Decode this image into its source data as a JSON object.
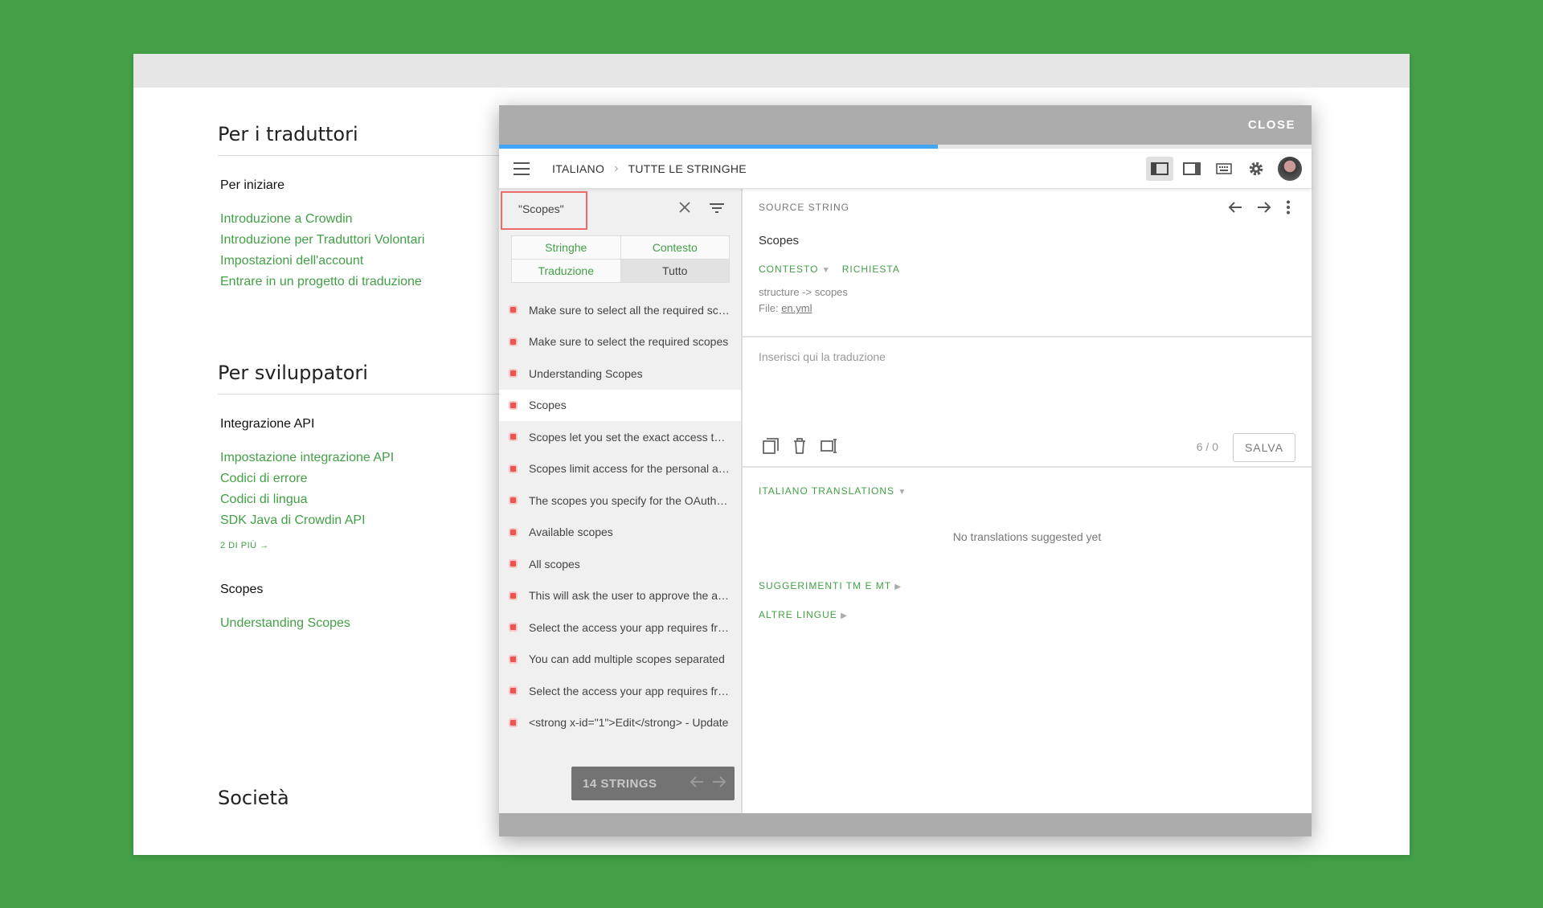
{
  "docs": {
    "translators": {
      "title": "Per i traduttori",
      "subtitle": "Per iniziare",
      "links": [
        "Introduzione a Crowdin",
        "Introduzione per Traduttori Volontari",
        "Impostazioni dell'account",
        "Entrare in un progetto di traduzione"
      ]
    },
    "developers": {
      "title": "Per sviluppatori",
      "subtitle": "Integrazione API",
      "links": [
        "Impostazione integrazione API",
        "Codici di errore",
        "Codici di lingua",
        "SDK Java di Crowdin API"
      ],
      "more": "2 DI PIÙ →",
      "scopes_title": "Scopes",
      "scopes_links": [
        "Understanding Scopes"
      ]
    },
    "company": {
      "title": "Società"
    }
  },
  "modal": {
    "close_label": "CLOSE",
    "progress": 0.54,
    "breadcrumb": {
      "language": "ITALIANO",
      "section": "TUTTE LE STRINGHE"
    },
    "icons": [
      "layout-left-icon",
      "layout-right-icon",
      "keyboard-icon",
      "gear-icon",
      "avatar"
    ]
  },
  "left": {
    "search_value": "\"Scopes\"",
    "filters": [
      "Stringhe",
      "Contesto",
      "Traduzione",
      "Tutto"
    ],
    "selected_filter": "Tutto",
    "strings": [
      "Make sure to select all the required scopes",
      "Make sure to select the required scopes",
      "Understanding Scopes",
      "Scopes",
      "Scopes let you set the exact access type",
      "Scopes limit access for the personal access",
      "The scopes you specify for the OAuth app",
      "Available scopes",
      "All scopes",
      "This will ask the user to approve the access",
      "Select the access your app requires from",
      "You can add multiple scopes separated",
      "Select the access your app requires from",
      "<strong x-id=\"1\">Edit</strong> - Update"
    ],
    "selected_index": 3,
    "pager_label": "14 STRINGS"
  },
  "right": {
    "source_label": "SOURCE STRING",
    "source_text": "Scopes",
    "context_label": "CONTESTO",
    "request_label": "RICHIESTA",
    "context_value": "structure -> scopes",
    "file_label": "File:",
    "file_name": "en.yml",
    "placeholder": "Inserisci qui la traduzione",
    "counter": "6 / 0",
    "save_label": "SALVA",
    "translations_label": "ITALIANO TRANSLATIONS",
    "no_translations": "No translations suggested yet",
    "tm_label": "SUGGERIMENTI TM E MT",
    "other_langs_label": "ALTRE LINGUE"
  }
}
